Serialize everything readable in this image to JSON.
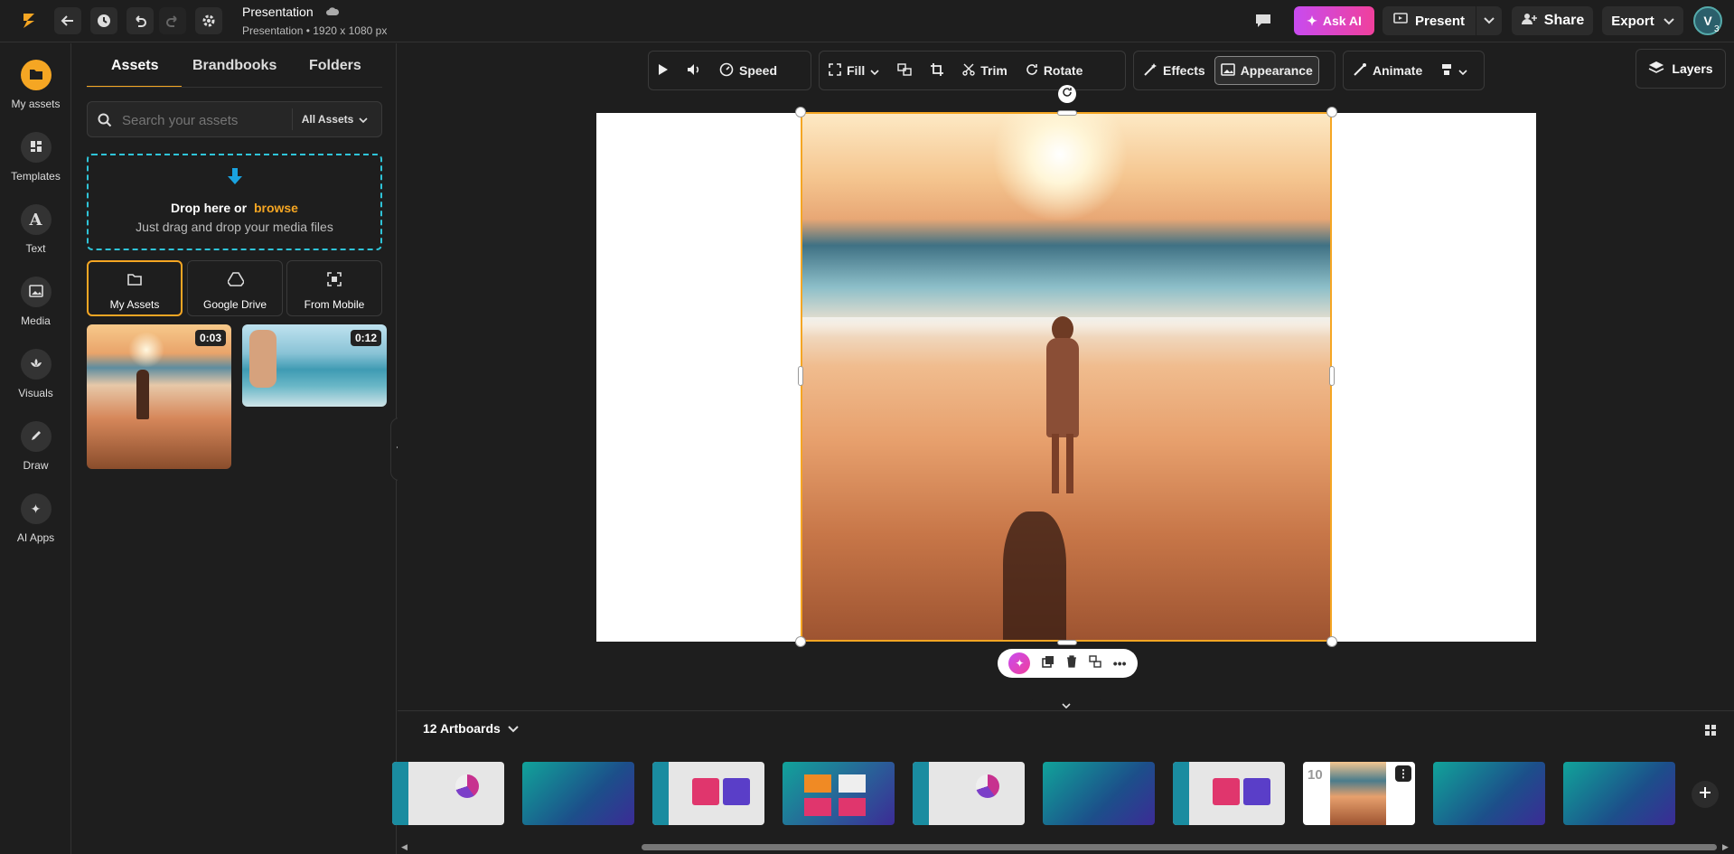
{
  "app": {
    "title": "Presentation",
    "subtitle": "Presentation • 1920 x 1080 px"
  },
  "topbar": {
    "ask_ai": "Ask AI",
    "present": "Present",
    "share": "Share",
    "export": "Export",
    "avatar_badge": "3"
  },
  "rail": [
    {
      "label": "My assets",
      "icon": "folder-icon"
    },
    {
      "label": "Templates",
      "icon": "templates-icon"
    },
    {
      "label": "Text",
      "icon": "text-icon"
    },
    {
      "label": "Media",
      "icon": "image-icon"
    },
    {
      "label": "Visuals",
      "icon": "visuals-icon"
    },
    {
      "label": "Draw",
      "icon": "pen-icon"
    },
    {
      "label": "AI Apps",
      "icon": "sparkle-icon"
    }
  ],
  "panel": {
    "tabs": [
      "Assets",
      "Brandbooks",
      "Folders"
    ],
    "search_placeholder": "Search your assets",
    "filter": "All Assets",
    "drop_title": "Drop here or",
    "drop_link": "browse",
    "drop_sub": "Just drag and drop your media files",
    "sources": [
      "My Assets",
      "Google Drive",
      "From Mobile"
    ],
    "media": [
      {
        "duration": "0:03"
      },
      {
        "duration": "0:12"
      }
    ]
  },
  "toolbar": {
    "speed": "Speed",
    "fill": "Fill",
    "trim": "Trim",
    "rotate": "Rotate",
    "effects": "Effects",
    "appearance": "Appearance",
    "animate": "Animate",
    "layers": "Layers"
  },
  "artboards": {
    "label": "12 Artboards",
    "current_number": "10"
  },
  "colors": {
    "accent": "#f5a623",
    "ai_gradient_start": "#c84bf0",
    "ai_gradient_end": "#f0409c",
    "drop_border": "#2fc4d8"
  }
}
